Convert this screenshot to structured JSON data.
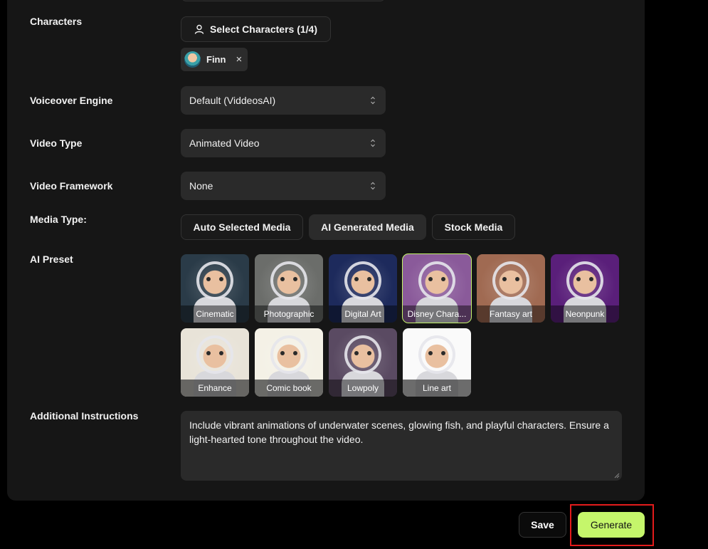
{
  "form": {
    "characters": {
      "label": "Characters",
      "select_button": "Select Characters (1/4)",
      "chips": [
        {
          "name": "Finn",
          "remove": "×"
        }
      ]
    },
    "voiceover": {
      "label": "Voiceover Engine",
      "value": "Default (ViddeosAI)"
    },
    "video_type": {
      "label": "Video Type",
      "value": "Animated Video"
    },
    "framework": {
      "label": "Video Framework",
      "value": "None"
    },
    "media_type": {
      "label": "Media Type:",
      "options": [
        "Auto Selected Media",
        "AI Generated Media",
        "Stock Media"
      ],
      "selected": "AI Generated Media"
    },
    "ai_preset": {
      "label": "AI Preset",
      "items": [
        {
          "name": "Cinematic",
          "bg": "#2a3b48"
        },
        {
          "name": "Photographic",
          "bg": "#6b6d6a"
        },
        {
          "name": "Digital Art",
          "bg": "#1d2a5c"
        },
        {
          "name": "Disney Chara...",
          "bg": "#8a5a9a"
        },
        {
          "name": "Fantasy art",
          "bg": "#a06a52"
        },
        {
          "name": "Neonpunk",
          "bg": "#5a1f7a"
        },
        {
          "name": "Enhance",
          "bg": "#e8e3d8"
        },
        {
          "name": "Comic book",
          "bg": "#f4f1e6"
        },
        {
          "name": "Lowpoly",
          "bg": "#5a4a62"
        },
        {
          "name": "Line art",
          "bg": "#fafafa"
        }
      ],
      "selected": "Disney Chara..."
    },
    "instructions": {
      "label": "Additional Instructions",
      "value": "Include vibrant animations of underwater scenes, glowing fish, and playful characters. Ensure a light-hearted tone throughout the video."
    }
  },
  "actions": {
    "save": "Save",
    "generate": "Generate"
  },
  "colors": {
    "accent": "#c5f66b",
    "highlight": "#e31b1b",
    "panel": "#161616"
  }
}
